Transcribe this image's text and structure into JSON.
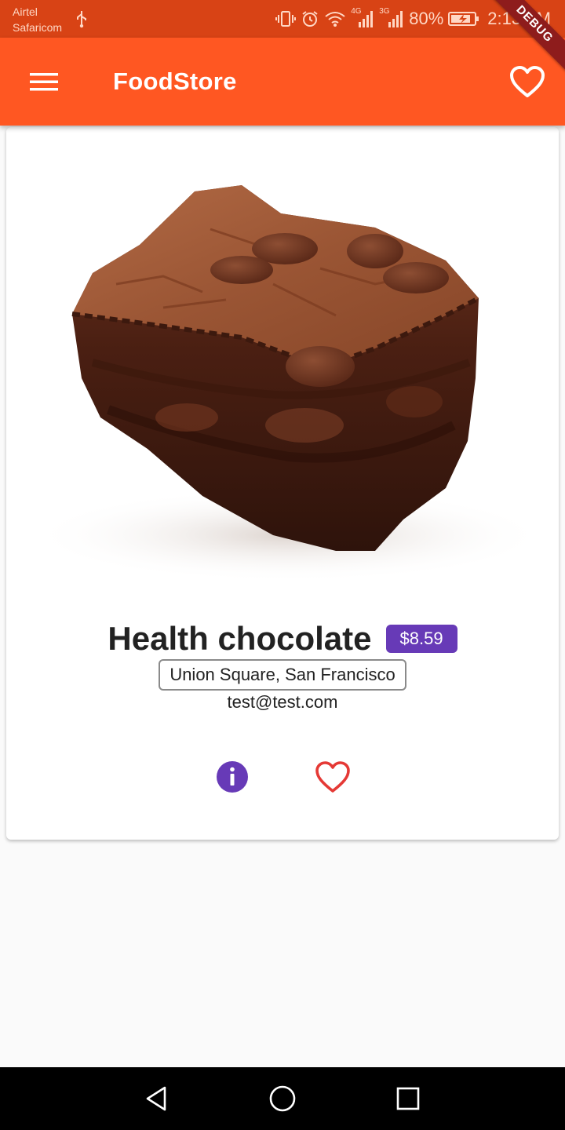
{
  "status_bar": {
    "carrier_1": "Airtel",
    "carrier_2": "Safaricom",
    "network_4g": "4G",
    "network_3g": "3G",
    "battery": "80%",
    "time": "2:13 AM"
  },
  "app_bar": {
    "menu_icon": "menu-icon",
    "title": "FoodStore",
    "favorites_icon": "heart-outline-icon"
  },
  "debug_banner": "DEBUG",
  "food": {
    "image": "chocolate-brownie",
    "name": "Health chocolate",
    "price": "$8.59",
    "location": "Union Square, San Francisco",
    "email": "test@test.com"
  },
  "actions": {
    "info_icon": "info-icon",
    "favorite_icon": "heart-outline-icon"
  },
  "colors": {
    "status_bar": "#d84315",
    "app_bar": "#ff5722",
    "price_badge": "#673ab7",
    "info_icon": "#673ab7",
    "favorite_icon": "#e53935"
  },
  "nav_bar": {
    "back_icon": "back-triangle-icon",
    "home_icon": "home-circle-icon",
    "recents_icon": "recents-square-icon"
  }
}
